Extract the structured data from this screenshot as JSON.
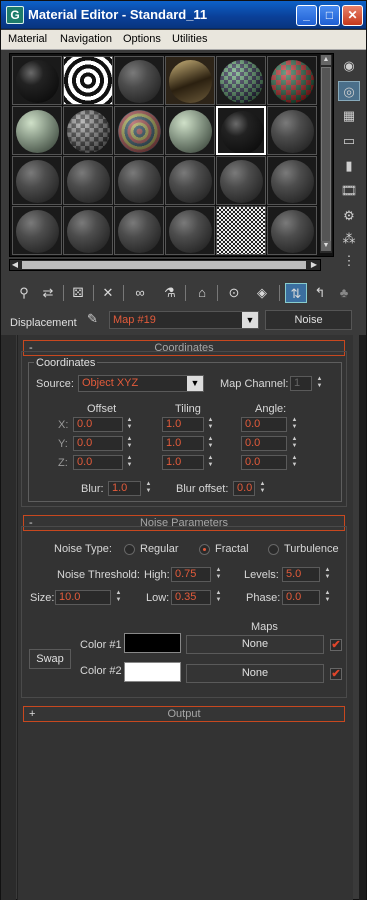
{
  "window": {
    "icon_label": "G",
    "title": "Material Editor - Standard_11",
    "controls": {
      "minimize": "_",
      "maximize": "□",
      "close": "✕"
    }
  },
  "menu": [
    "Material",
    "Navigation",
    "Options",
    "Utilities"
  ],
  "sample_slots": {
    "rows": 4,
    "columns": 6,
    "active_slot": "row 2, column 5"
  },
  "side_toolbar_icons": [
    "sample-type-icon",
    "backlight-icon",
    "background-checker-icon",
    "sample-uv-tiling-icon",
    "video-color-check-icon",
    "make-preview-icon",
    "options-icon",
    "select-by-material-icon",
    "material-map-navigator-icon"
  ],
  "bottom_toolbar_icons": [
    "get-material-icon",
    "put-to-scene-icon",
    "assign-to-selection-icon",
    "reset-map-icon",
    "make-unique-icon",
    "put-to-library-icon",
    "material-id-channel-icon",
    "show-map-in-viewport-icon",
    "show-end-result-icon",
    "go-to-parent-icon",
    "go-forward-to-sibling-icon"
  ],
  "map_row": {
    "label": "Displacement",
    "map_name": "Map #19",
    "map_type": "Noise"
  },
  "coordinates": {
    "rollout_sign": "-",
    "rollout_title": "Coordinates",
    "group_title": "Coordinates",
    "source_label": "Source:",
    "source_value": "Object XYZ",
    "map_channel_label": "Map Channel:",
    "map_channel_value": "1",
    "headers": {
      "offset": "Offset",
      "tiling": "Tiling",
      "angle": "Angle:"
    },
    "rows": [
      {
        "axis": "X:",
        "offset": "0.0",
        "tiling": "1.0",
        "angle": "0.0"
      },
      {
        "axis": "Y:",
        "offset": "0.0",
        "tiling": "1.0",
        "angle": "0.0"
      },
      {
        "axis": "Z:",
        "offset": "0.0",
        "tiling": "1.0",
        "angle": "0.0"
      }
    ],
    "blur_label": "Blur:",
    "blur_value": "1.0",
    "blur_offset_label": "Blur offset:",
    "blur_offset_value": "0.0"
  },
  "noise": {
    "rollout_sign": "-",
    "rollout_title": "Noise Parameters",
    "type_label": "Noise Type:",
    "types": [
      "Regular",
      "Fractal",
      "Turbulence"
    ],
    "selected_type": "Fractal",
    "threshold_label": "Noise Threshold:",
    "high_label": "High:",
    "high_value": "0.75",
    "levels_label": "Levels:",
    "levels_value": "5.0",
    "size_label": "Size:",
    "size_value": "10.0",
    "low_label": "Low:",
    "low_value": "0.35",
    "phase_label": "Phase:",
    "phase_value": "0.0",
    "maps_label": "Maps",
    "swap_label": "Swap",
    "color1_label": "Color #1",
    "color1_hex": "#000000",
    "color1_map": "None",
    "color1_map_enabled": true,
    "color2_label": "Color #2",
    "color2_hex": "#ffffff",
    "color2_map": "None",
    "color2_map_enabled": true,
    "check_glyph": "✔"
  },
  "output": {
    "rollout_sign": "+",
    "rollout_title": "Output"
  },
  "colors": {
    "accent": "#e35b3b",
    "rollout_border": "#c8481f",
    "titlebar": "#0a3f97"
  }
}
